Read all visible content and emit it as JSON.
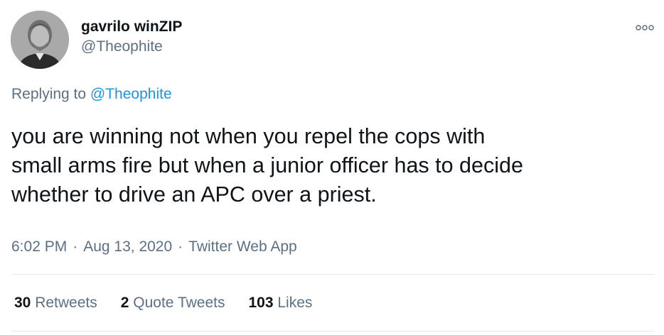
{
  "author": {
    "display_name": "gavrilo winZIP",
    "handle": "@Theophite"
  },
  "reply": {
    "prefix": "Replying to",
    "mention": "@Theophite"
  },
  "tweet_text": "you are winning not when you repel the cops with\nsmall arms fire but when a junior officer has to decide\nwhether to drive an APC over a priest.",
  "meta": {
    "time": "6:02 PM",
    "separator": "·",
    "date": "Aug 13, 2020",
    "source": "Twitter Web App"
  },
  "stats": {
    "retweets_count": "30",
    "retweets_label": "Retweets",
    "quotes_count": "2",
    "quotes_label": "Quote Tweets",
    "likes_count": "103",
    "likes_label": "Likes"
  },
  "icons": {
    "more": "more-options-icon",
    "avatar": "profile-avatar"
  },
  "colors": {
    "text": "#0f1419",
    "secondary": "#5b7083",
    "link": "#1b95e0",
    "divider": "#e1e8ed"
  }
}
